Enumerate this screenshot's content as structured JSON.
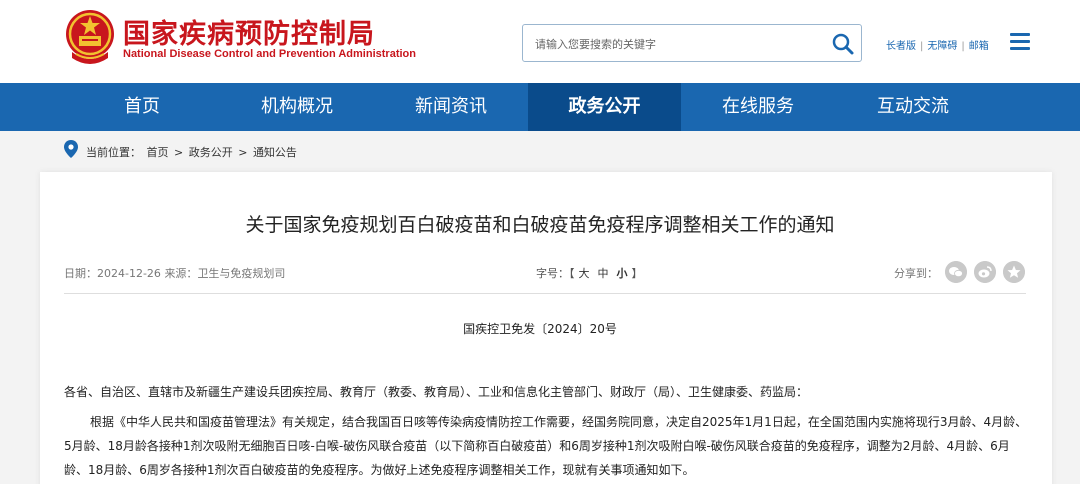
{
  "header": {
    "title_cn": "国家疾病预防控制局",
    "title_en": "National Disease Control and Prevention Administration",
    "search_placeholder": "请输入您要搜索的关键字",
    "links": [
      "长者版",
      "无障碍",
      "邮箱"
    ]
  },
  "nav": {
    "items": [
      "首页",
      "机构概况",
      "新闻资讯",
      "政务公开",
      "在线服务",
      "互动交流"
    ],
    "active": "政务公开"
  },
  "breadcrumb": {
    "label": "当前位置：",
    "items": [
      "首页",
      "政务公开",
      "通知公告"
    ]
  },
  "article": {
    "title": "关于国家免疫规划百白破疫苗和白破疫苗免疫程序调整相关工作的通知",
    "date_label": "日期：",
    "date": "2024-12-26",
    "source_label": "来源：",
    "source": "卫生与免疫规划司",
    "fontsize_label": "字号：",
    "fontsize_open": "【",
    "fontsize_large": "大",
    "fontsize_mid": "中",
    "fontsize_small": "小",
    "fontsize_close": "】",
    "share_label": "分享到：",
    "doc_number": "国疾控卫免发〔2024〕20号",
    "recipients": "各省、自治区、直辖市及新疆生产建设兵团疾控局、教育厅（教委、教育局）、工业和信息化主管部门、财政厅（局）、卫生健康委、药监局：",
    "body": "根据《中华人民共和国疫苗管理法》有关规定，结合我国百日咳等传染病疫情防控工作需要，经国务院同意，决定自2025年1月1日起，在全国范围内实施将现行3月龄、4月龄、5月龄、18月龄各接种1剂次吸附无细胞百日咳-白喉-破伤风联合疫苗（以下简称百白破疫苗）和6周岁接种1剂次吸附白喉-破伤风联合疫苗的免疫程序，调整为2月龄、4月龄、6月龄、18月龄、6周岁各接种1剂次百白破疫苗的免疫程序。为做好上述免疫程序调整相关工作，现就有关事项通知如下。"
  },
  "colors": {
    "brand_red": "#c8161d",
    "nav_blue": "#1a67b0",
    "nav_active": "#0a4b8b"
  }
}
